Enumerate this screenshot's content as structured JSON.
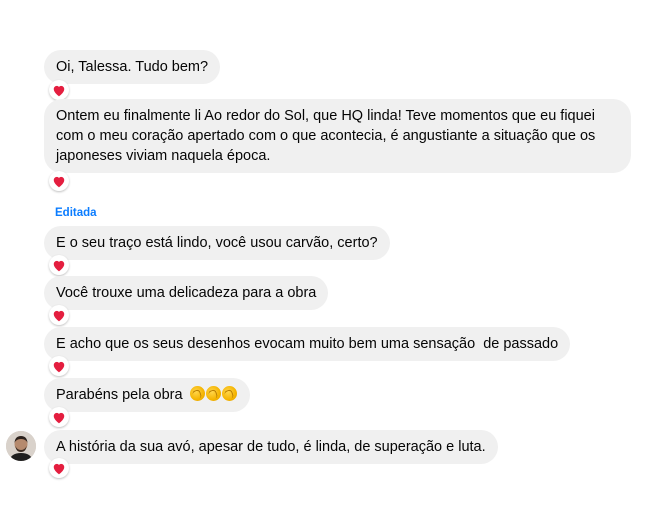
{
  "messages": [
    {
      "text": "Oi, Talessa. Tudo bem?",
      "reaction": "heart"
    },
    {
      "text": "Ontem eu finalmente li Ao redor do Sol, que HQ linda! Teve momentos que eu fiquei com o meu coração apertado com o que acontecia, é angustiante a situação que os japoneses viviam naquela época.",
      "reaction": "heart"
    },
    {
      "text": "E o seu traço está lindo, você usou carvão, certo?",
      "reaction": "heart",
      "status": "Editada"
    },
    {
      "text": "Você trouxe uma delicadeza para a obra",
      "reaction": "heart"
    },
    {
      "text": "E acho que os seus desenhos evocam muito bem uma sensação  de passado",
      "reaction": "heart"
    },
    {
      "text": "Parabéns pela obra",
      "emoji": "clapping-hands x3",
      "reaction": "heart"
    },
    {
      "text": "A história da sua avó, apesar de tudo, é linda, de superação e luta.",
      "reaction": "heart"
    }
  ],
  "colors": {
    "bubble": "#f0f0f0",
    "heart": "#e41e3f",
    "edited_label": "#0a7cff"
  }
}
